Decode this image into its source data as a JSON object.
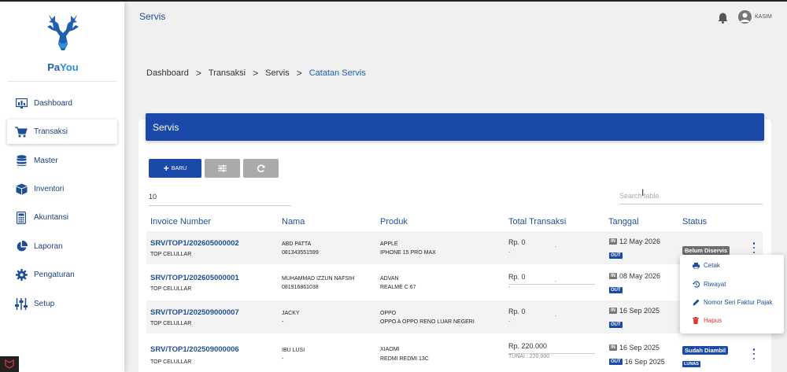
{
  "app": {
    "logo_text_1": "Pa",
    "logo_text_2": "You",
    "page_title": "Servis"
  },
  "user": {
    "name": "KASIM"
  },
  "sidebar": {
    "items": [
      {
        "label": "Dashboard",
        "icon": "dashboard-icon"
      },
      {
        "label": "Transaksi",
        "icon": "cart-icon"
      },
      {
        "label": "Master",
        "icon": "database-icon"
      },
      {
        "label": "Inventori",
        "icon": "box-icon"
      },
      {
        "label": "Akuntansi",
        "icon": "calculator-icon"
      },
      {
        "label": "Laporan",
        "icon": "pie-chart-icon"
      },
      {
        "label": "Pengaturan",
        "icon": "gear-icon"
      },
      {
        "label": "Setup",
        "icon": "sliders-icon"
      }
    ]
  },
  "breadcrumb": {
    "items": [
      "Dashboard",
      "Transaksi",
      "Servis"
    ],
    "current": "Catatan Servis",
    "separator": ">"
  },
  "card": {
    "title": "Servis"
  },
  "toolbar": {
    "new_label": "BARU"
  },
  "page_size": "10",
  "search": {
    "placeholder": "Search table"
  },
  "table": {
    "headers": [
      "Invoice Number",
      "Nama",
      "Produk",
      "Total Transaksi",
      "Tanggal",
      "Status"
    ],
    "rows": [
      {
        "invoice": "SRV/TOP1/202605000002",
        "store": "TOP CELULLAR",
        "name": "ABD PATTA",
        "phone": "081343551599",
        "brand": "APPLE",
        "product": "IPHONE 15 PRO MAX",
        "total": "Rp. 0",
        "total_sub": "-",
        "in_tag": "IN",
        "date_in": "12 May 2026",
        "out_tag": "OUT",
        "date_out": "",
        "status": "Belum Diservis",
        "status_sub": ""
      },
      {
        "invoice": "SRV/TOP1/202605000001",
        "store": "TOP CELULLAR",
        "name": "MUHAMMAD IZZUN NAFSIH",
        "phone": "081916861038",
        "brand": "ADVAN",
        "product": "REALME C 67",
        "total": "Rp. 0",
        "total_sub": "-",
        "in_tag": "IN",
        "date_in": "08 May 2026",
        "out_tag": "OUT",
        "date_out": "",
        "status": "",
        "status_sub": ""
      },
      {
        "invoice": "SRV/TOP1/202509000007",
        "store": "TOP CELULLAR",
        "name": "JACKY",
        "phone": "-",
        "brand": "OPPO",
        "product": "OPPO A OPPO RENO LUAR NEGERI",
        "total": "Rp. 0",
        "total_sub": "-",
        "in_tag": "IN",
        "date_in": "16 Sep 2025",
        "out_tag": "OUT",
        "date_out": "",
        "status": "",
        "status_sub": ""
      },
      {
        "invoice": "SRV/TOP1/202509000006",
        "store": "TOP CELULLAR",
        "name": "IBU LUSI",
        "phone": "-",
        "brand": "XIAOMI",
        "product": "REDMI REDMI 13C",
        "total": "Rp. 220.000",
        "total_sub": "TUNAI : 220,000",
        "in_tag": "IN",
        "date_in": "16 Sep 2025",
        "out_tag": "OUT",
        "date_out": "16 Sep 2025",
        "status": "Sudah Diambil",
        "status_sub": "LUNAS"
      }
    ]
  },
  "dropdown": {
    "items": [
      {
        "label": "Cetak",
        "icon": "printer-icon"
      },
      {
        "label": "Riwayat",
        "icon": "history-icon"
      },
      {
        "label": "Nomor Seri Faktur Pajak",
        "icon": "pencil-icon"
      },
      {
        "label": "Hapus",
        "icon": "trash-icon"
      }
    ]
  },
  "colors": {
    "primary": "#1b49aa",
    "brand_text": "#1f4e96",
    "danger": "#dd3333"
  }
}
